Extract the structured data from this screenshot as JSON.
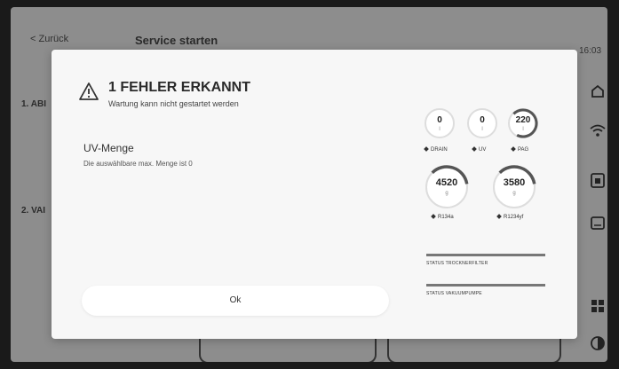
{
  "background": {
    "back_label": "< Zurück",
    "title": "Service starten",
    "time": "16:03",
    "step1": "1. ABI",
    "step2": "2. VAI"
  },
  "modal": {
    "title": "1 FEHLER ERKANNT",
    "subtitle": "Wartung kann nicht gestartet werden",
    "field_label": "UV-Menge",
    "field_message": "Die auswählbare max. Menge ist 0",
    "ok_label": "Ok"
  },
  "gauges": {
    "top": [
      {
        "value": "0",
        "unit": "l",
        "label": "DRAIN",
        "fill": 0
      },
      {
        "value": "0",
        "unit": "l",
        "label": "UV",
        "fill": 0
      },
      {
        "value": "220",
        "unit": "l",
        "label": "PAG",
        "fill": 0.7
      }
    ],
    "bottom": [
      {
        "value": "4520",
        "unit": "g",
        "label": "R134a",
        "fill": 0.35
      },
      {
        "value": "3580",
        "unit": "g",
        "label": "R1234yf",
        "fill": 0.35
      }
    ]
  },
  "status": {
    "dryer_label": "STATUS TROCKNERFILTER",
    "pump_label": "STATUS VAKUUMPUMPE"
  }
}
